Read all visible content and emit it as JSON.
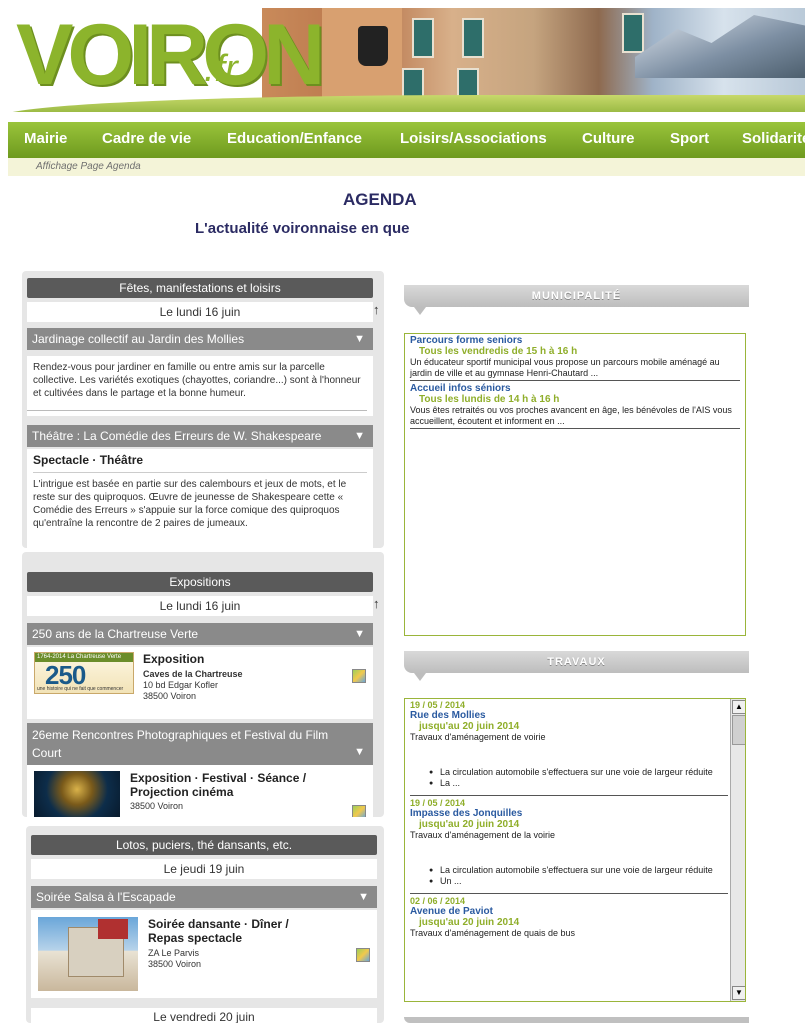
{
  "brand": {
    "logo": "VOIRON",
    "logo_suffix": ".fr"
  },
  "nav": {
    "items": [
      "Mairie",
      "Cadre de vie",
      "Education/Enfance",
      "Loisirs/Associations",
      "Culture",
      "Sport",
      "Solidarité"
    ]
  },
  "breadcrumb": "Affichage Page Agenda",
  "page": {
    "title": "AGENDA",
    "subtitle": "L'actualité voironnaise en que"
  },
  "left": {
    "fetes": {
      "header": "Fêtes, manifestations et loisirs",
      "date": "Le lundi 16 juin",
      "events": [
        {
          "title": "Jardinage collectif au Jardin des Mollies",
          "text": "Rendez-vous pour jardiner en famille ou entre amis sur la parcelle collective. Les variétés exotiques (chayottes, coriandre...) sont à l'honneur et cultivées dans le partage et la bonne humeur."
        },
        {
          "title": "Théâtre : La Comédie des Erreurs de W. Shakespeare",
          "category": "Spectacle · Théâtre",
          "text": "L'intrigue est basée en partie sur des calembours et jeux de mots, et le reste sur des quiproquos. Œuvre de jeunesse de Shakespeare cette « Comédie des Erreurs » s'appuie sur la force comique des quiproquos qu'entraîne la rencontre de 2 paires de jumeaux."
        }
      ]
    },
    "expositions": {
      "header": "Expositions",
      "date": "Le lundi 16 juin",
      "events": [
        {
          "title": "250 ans de la Chartreuse Verte",
          "category": "Exposition",
          "venue": "Caves de la Chartreuse",
          "addr1": "10 bd Edgar Kofler",
          "addr2": "38500 Voiron",
          "thumb_top": "1764-2014  La Chartreuse Verte",
          "thumb_big": "250",
          "thumb_bottom": "une histoire qui ne fait que commencer"
        },
        {
          "title": "26eme Rencontres Photographiques et Festival du Film Court",
          "category": "Exposition · Festival · Séance / Projection cinéma",
          "addr2": "38500 Voiron"
        }
      ]
    },
    "lotos": {
      "header": "Lotos, puciers, thé dansants, etc.",
      "date": "Le jeudi 19 juin",
      "events": [
        {
          "title": "Soirée Salsa à l'Escapade",
          "category": "Soirée dansante · Dîner / Repas spectacle",
          "addr1": "ZA Le Parvis",
          "addr2": "38500 Voiron"
        }
      ],
      "date2": "Le vendredi 20 juin"
    }
  },
  "right": {
    "municipalite": {
      "header": "MUNICIPALITÉ",
      "items": [
        {
          "title": "Parcours forme seniors",
          "when": "Tous les vendredis de 15 h à 16 h",
          "desc": "Un éducateur sportif municipal vous propose un parcours mobile aménagé au jardin de ville et au gymnase Henri-Chautard ..."
        },
        {
          "title": "Accueil infos séniors",
          "when": "Tous les lundis de 14 h à 16 h",
          "desc": "Vous êtes retraités ou vos proches avancent en âge, les bénévoles de l'AIS vous accueillent, écoutent et informent en ..."
        }
      ]
    },
    "travaux": {
      "header": "TRAVAUX",
      "items": [
        {
          "date": "19 / 05 / 2014",
          "title": "Rue des Mollies",
          "when": "jusqu'au 20 juin 2014",
          "desc": "Travaux d'aménagement de voirie",
          "bullets": [
            "La circulation automobile s'effectuera sur une voie de largeur réduite",
            "La ..."
          ]
        },
        {
          "date": "19 / 05 / 2014",
          "title": "Impasse des Jonquilles",
          "when": "jusqu'au 20 juin 2014",
          "desc": "Travaux d'aménagement de la voirie",
          "bullets": [
            "La circulation automobile s'effectuera sur une voie de largeur réduite",
            "Un ..."
          ]
        },
        {
          "date": "02 / 06 / 2014",
          "title": "Avenue de Paviot",
          "when": "jusqu'au 20 juin 2014",
          "desc": "Travaux d'aménagement de quais de bus"
        }
      ]
    }
  }
}
